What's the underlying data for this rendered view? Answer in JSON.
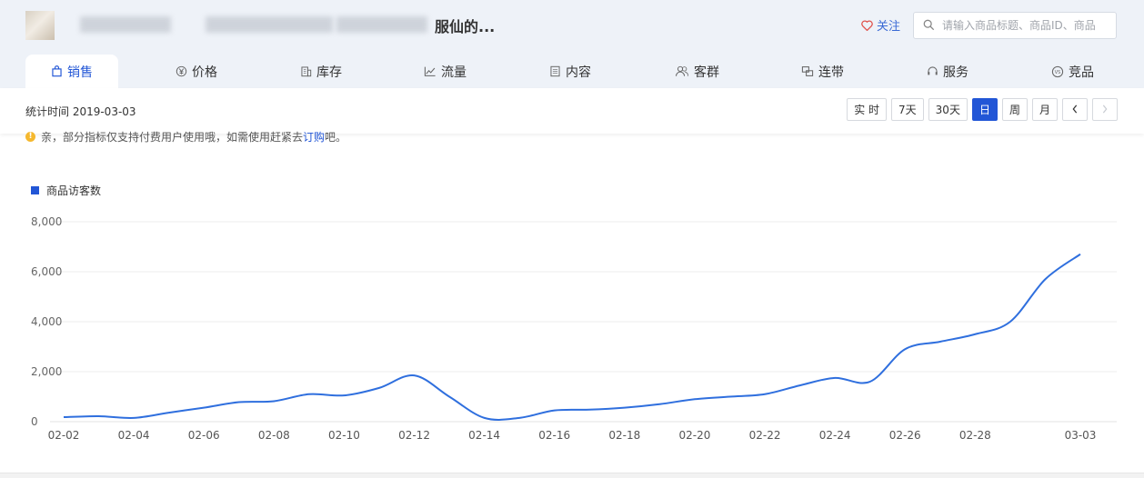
{
  "header": {
    "title_visible": "服仙的...",
    "follow_label": "关注",
    "search_placeholder": "请输入商品标题、商品ID、商品"
  },
  "tabs": [
    {
      "label": "销售",
      "icon": "shopping-bag-icon",
      "active": true
    },
    {
      "label": "价格",
      "icon": "yen-icon",
      "active": false
    },
    {
      "label": "库存",
      "icon": "building-icon",
      "active": false
    },
    {
      "label": "流量",
      "icon": "line-chart-icon",
      "active": false
    },
    {
      "label": "内容",
      "icon": "document-icon",
      "active": false
    },
    {
      "label": "客群",
      "icon": "users-icon",
      "active": false
    },
    {
      "label": "连带",
      "icon": "link-boxes-icon",
      "active": false
    },
    {
      "label": "服务",
      "icon": "headset-icon",
      "active": false
    },
    {
      "label": "竞品",
      "icon": "vs-icon",
      "active": false
    }
  ],
  "toolbar": {
    "stat_time": "统计时间 2019-03-03",
    "buttons": {
      "realtime": "实 时",
      "d7": "7天",
      "d30": "30天",
      "day": "日",
      "week": "周",
      "month": "月",
      "prev": "‹",
      "next": "›"
    },
    "active_button": "日"
  },
  "notice": {
    "text": "亲，部分指标仅支持付费用户使用哦，如需使用赶紧去",
    "link": "订购",
    "suffix": "吧。"
  },
  "colors": {
    "accent": "#2256d6",
    "line": "#2f6fde",
    "header_bg": "#eef2f8"
  },
  "chart_data": {
    "type": "line",
    "legend": "商品访客数",
    "legend_position": "top-left",
    "grid": true,
    "ylim": [
      0,
      8000
    ],
    "y_ticks": [
      "0",
      "2,000",
      "4,000",
      "6,000",
      "8,000"
    ],
    "x_tick_labels": [
      "02-02",
      "02-04",
      "02-06",
      "02-08",
      "02-10",
      "02-12",
      "02-14",
      "02-16",
      "02-18",
      "02-20",
      "02-22",
      "02-24",
      "02-26",
      "02-28",
      "03-03"
    ],
    "x": [
      "02-02",
      "02-03",
      "02-04",
      "02-05",
      "02-06",
      "02-07",
      "02-08",
      "02-09",
      "02-10",
      "02-11",
      "02-12",
      "02-13",
      "02-14",
      "02-15",
      "02-16",
      "02-17",
      "02-18",
      "02-19",
      "02-20",
      "02-21",
      "02-22",
      "02-23",
      "02-24",
      "02-25",
      "02-26",
      "02-27",
      "02-28",
      "03-01",
      "03-02",
      "03-03"
    ],
    "series": [
      {
        "name": "商品访客数",
        "values": [
          180,
          220,
          150,
          360,
          560,
          780,
          820,
          1100,
          1050,
          1350,
          1850,
          1000,
          150,
          150,
          450,
          480,
          560,
          700,
          900,
          1000,
          1100,
          1450,
          1750,
          1600,
          2900,
          3200,
          3500,
          4000,
          5700,
          6700
        ]
      }
    ]
  }
}
